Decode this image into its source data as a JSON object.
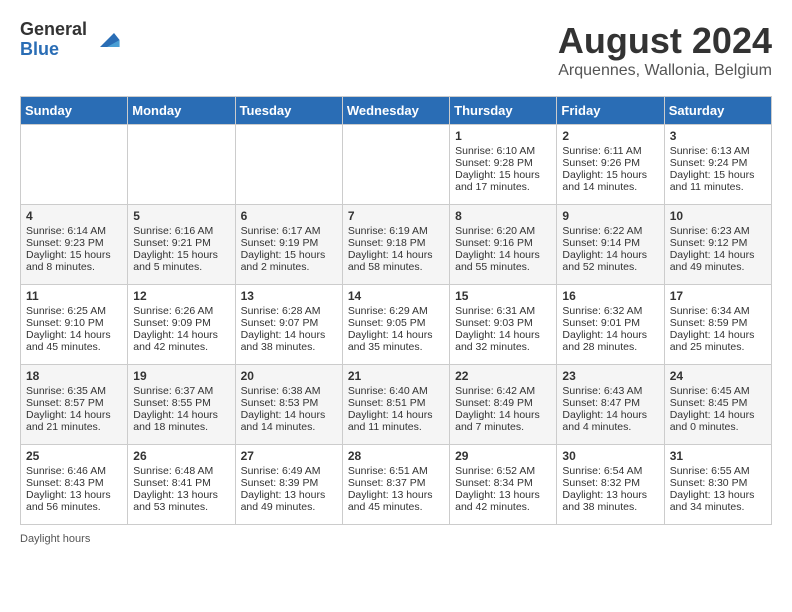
{
  "logo": {
    "general": "General",
    "blue": "Blue"
  },
  "title": "August 2024",
  "location": "Arquennes, Wallonia, Belgium",
  "days_header": [
    "Sunday",
    "Monday",
    "Tuesday",
    "Wednesday",
    "Thursday",
    "Friday",
    "Saturday"
  ],
  "weeks": [
    [
      {
        "day": "",
        "sunrise": "",
        "sunset": "",
        "daylight": ""
      },
      {
        "day": "",
        "sunrise": "",
        "sunset": "",
        "daylight": ""
      },
      {
        "day": "",
        "sunrise": "",
        "sunset": "",
        "daylight": ""
      },
      {
        "day": "",
        "sunrise": "",
        "sunset": "",
        "daylight": ""
      },
      {
        "day": "1",
        "sunrise": "Sunrise: 6:10 AM",
        "sunset": "Sunset: 9:28 PM",
        "daylight": "Daylight: 15 hours and 17 minutes."
      },
      {
        "day": "2",
        "sunrise": "Sunrise: 6:11 AM",
        "sunset": "Sunset: 9:26 PM",
        "daylight": "Daylight: 15 hours and 14 minutes."
      },
      {
        "day": "3",
        "sunrise": "Sunrise: 6:13 AM",
        "sunset": "Sunset: 9:24 PM",
        "daylight": "Daylight: 15 hours and 11 minutes."
      }
    ],
    [
      {
        "day": "4",
        "sunrise": "Sunrise: 6:14 AM",
        "sunset": "Sunset: 9:23 PM",
        "daylight": "Daylight: 15 hours and 8 minutes."
      },
      {
        "day": "5",
        "sunrise": "Sunrise: 6:16 AM",
        "sunset": "Sunset: 9:21 PM",
        "daylight": "Daylight: 15 hours and 5 minutes."
      },
      {
        "day": "6",
        "sunrise": "Sunrise: 6:17 AM",
        "sunset": "Sunset: 9:19 PM",
        "daylight": "Daylight: 15 hours and 2 minutes."
      },
      {
        "day": "7",
        "sunrise": "Sunrise: 6:19 AM",
        "sunset": "Sunset: 9:18 PM",
        "daylight": "Daylight: 14 hours and 58 minutes."
      },
      {
        "day": "8",
        "sunrise": "Sunrise: 6:20 AM",
        "sunset": "Sunset: 9:16 PM",
        "daylight": "Daylight: 14 hours and 55 minutes."
      },
      {
        "day": "9",
        "sunrise": "Sunrise: 6:22 AM",
        "sunset": "Sunset: 9:14 PM",
        "daylight": "Daylight: 14 hours and 52 minutes."
      },
      {
        "day": "10",
        "sunrise": "Sunrise: 6:23 AM",
        "sunset": "Sunset: 9:12 PM",
        "daylight": "Daylight: 14 hours and 49 minutes."
      }
    ],
    [
      {
        "day": "11",
        "sunrise": "Sunrise: 6:25 AM",
        "sunset": "Sunset: 9:10 PM",
        "daylight": "Daylight: 14 hours and 45 minutes."
      },
      {
        "day": "12",
        "sunrise": "Sunrise: 6:26 AM",
        "sunset": "Sunset: 9:09 PM",
        "daylight": "Daylight: 14 hours and 42 minutes."
      },
      {
        "day": "13",
        "sunrise": "Sunrise: 6:28 AM",
        "sunset": "Sunset: 9:07 PM",
        "daylight": "Daylight: 14 hours and 38 minutes."
      },
      {
        "day": "14",
        "sunrise": "Sunrise: 6:29 AM",
        "sunset": "Sunset: 9:05 PM",
        "daylight": "Daylight: 14 hours and 35 minutes."
      },
      {
        "day": "15",
        "sunrise": "Sunrise: 6:31 AM",
        "sunset": "Sunset: 9:03 PM",
        "daylight": "Daylight: 14 hours and 32 minutes."
      },
      {
        "day": "16",
        "sunrise": "Sunrise: 6:32 AM",
        "sunset": "Sunset: 9:01 PM",
        "daylight": "Daylight: 14 hours and 28 minutes."
      },
      {
        "day": "17",
        "sunrise": "Sunrise: 6:34 AM",
        "sunset": "Sunset: 8:59 PM",
        "daylight": "Daylight: 14 hours and 25 minutes."
      }
    ],
    [
      {
        "day": "18",
        "sunrise": "Sunrise: 6:35 AM",
        "sunset": "Sunset: 8:57 PM",
        "daylight": "Daylight: 14 hours and 21 minutes."
      },
      {
        "day": "19",
        "sunrise": "Sunrise: 6:37 AM",
        "sunset": "Sunset: 8:55 PM",
        "daylight": "Daylight: 14 hours and 18 minutes."
      },
      {
        "day": "20",
        "sunrise": "Sunrise: 6:38 AM",
        "sunset": "Sunset: 8:53 PM",
        "daylight": "Daylight: 14 hours and 14 minutes."
      },
      {
        "day": "21",
        "sunrise": "Sunrise: 6:40 AM",
        "sunset": "Sunset: 8:51 PM",
        "daylight": "Daylight: 14 hours and 11 minutes."
      },
      {
        "day": "22",
        "sunrise": "Sunrise: 6:42 AM",
        "sunset": "Sunset: 8:49 PM",
        "daylight": "Daylight: 14 hours and 7 minutes."
      },
      {
        "day": "23",
        "sunrise": "Sunrise: 6:43 AM",
        "sunset": "Sunset: 8:47 PM",
        "daylight": "Daylight: 14 hours and 4 minutes."
      },
      {
        "day": "24",
        "sunrise": "Sunrise: 6:45 AM",
        "sunset": "Sunset: 8:45 PM",
        "daylight": "Daylight: 14 hours and 0 minutes."
      }
    ],
    [
      {
        "day": "25",
        "sunrise": "Sunrise: 6:46 AM",
        "sunset": "Sunset: 8:43 PM",
        "daylight": "Daylight: 13 hours and 56 minutes."
      },
      {
        "day": "26",
        "sunrise": "Sunrise: 6:48 AM",
        "sunset": "Sunset: 8:41 PM",
        "daylight": "Daylight: 13 hours and 53 minutes."
      },
      {
        "day": "27",
        "sunrise": "Sunrise: 6:49 AM",
        "sunset": "Sunset: 8:39 PM",
        "daylight": "Daylight: 13 hours and 49 minutes."
      },
      {
        "day": "28",
        "sunrise": "Sunrise: 6:51 AM",
        "sunset": "Sunset: 8:37 PM",
        "daylight": "Daylight: 13 hours and 45 minutes."
      },
      {
        "day": "29",
        "sunrise": "Sunrise: 6:52 AM",
        "sunset": "Sunset: 8:34 PM",
        "daylight": "Daylight: 13 hours and 42 minutes."
      },
      {
        "day": "30",
        "sunrise": "Sunrise: 6:54 AM",
        "sunset": "Sunset: 8:32 PM",
        "daylight": "Daylight: 13 hours and 38 minutes."
      },
      {
        "day": "31",
        "sunrise": "Sunrise: 6:55 AM",
        "sunset": "Sunset: 8:30 PM",
        "daylight": "Daylight: 13 hours and 34 minutes."
      }
    ]
  ],
  "footer": {
    "daylight_label": "Daylight hours"
  }
}
